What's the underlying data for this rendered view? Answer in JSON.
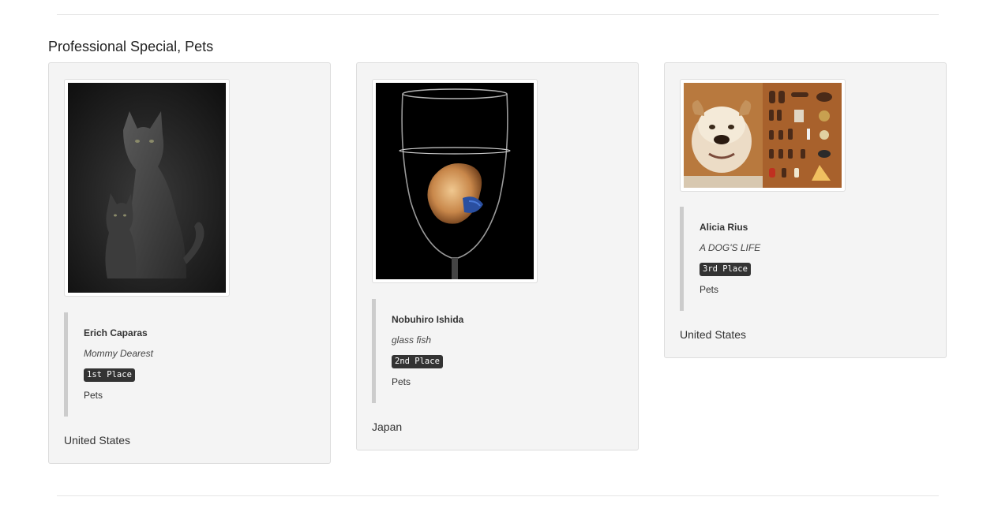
{
  "section": {
    "title": "Professional Special, Pets"
  },
  "entries": [
    {
      "photographer": "Erich Caparas",
      "title": "Mommy Dearest",
      "place": "1st Place",
      "category": "Pets",
      "country": "United States"
    },
    {
      "photographer": "Nobuhiro Ishida",
      "title": "glass fish",
      "place": "2nd Place",
      "category": "Pets",
      "country": "Japan"
    },
    {
      "photographer": "Alicia Rius",
      "title": "A DOG'S LIFE",
      "place": "3rd Place",
      "category": "Pets",
      "country": "United States"
    }
  ],
  "colors": {
    "card_background": "#f4f4f4",
    "badge_background": "#333333",
    "info_border": "#cccccc"
  }
}
